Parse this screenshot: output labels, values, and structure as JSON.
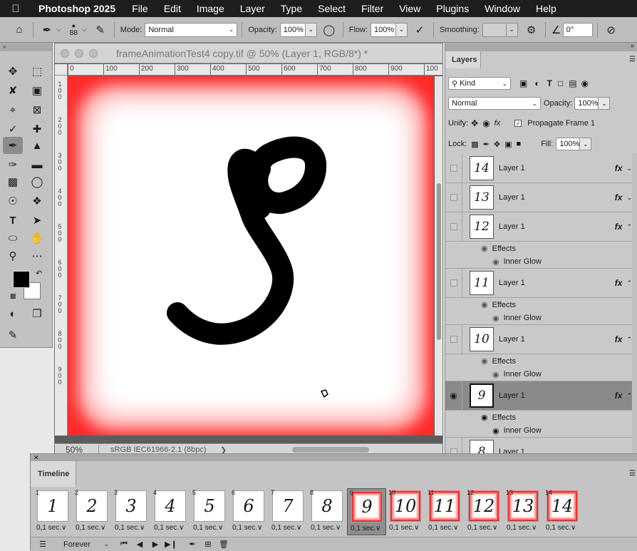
{
  "menubar": {
    "app": "Photoshop 2025",
    "items": [
      "File",
      "Edit",
      "Image",
      "Layer",
      "Type",
      "Select",
      "Filter",
      "View",
      "Plugins",
      "Window",
      "Help"
    ]
  },
  "options": {
    "brush_size": "88",
    "mode_label": "Mode:",
    "mode_value": "Normal",
    "opacity_label": "Opacity:",
    "opacity_value": "100%",
    "flow_label": "Flow:",
    "flow_value": "100%",
    "smoothing_label": "Smoothing:",
    "smoothing_value": "",
    "angle_value": "0°"
  },
  "document": {
    "title": "frameAnimationTest4 copy.tif @ 50% (Layer 1, RGB/8*) *",
    "zoom": "50%",
    "profile": "sRGB IEC61966-2.1 (8bpc)",
    "arrow": "❯",
    "ruler_h": [
      "0",
      "100",
      "200",
      "300",
      "400",
      "500",
      "600",
      "700",
      "800",
      "900",
      "100"
    ],
    "ruler_v": [
      "1 0 0",
      "2 0 0",
      "3 0 0",
      "4 0 0",
      "5 0 0",
      "6 0 0",
      "7 0 0",
      "8 0 0",
      "9 0 0"
    ]
  },
  "layers_panel": {
    "tab": "Layers",
    "filter_kind": "Kind",
    "blend_mode": "Normal",
    "opacity_label": "Opacity:",
    "opacity_value": "100%",
    "unify_label": "Unify:",
    "propagate_label": "Propagate Frame 1",
    "lock_label": "Lock:",
    "fill_label": "Fill:",
    "fill_value": "100%",
    "effects_label": "Effects",
    "inner_glow_label": "Inner Glow",
    "layers": [
      {
        "name": "Layer 1",
        "thumb": "14",
        "fx": "fx",
        "visible": false,
        "expanded": false
      },
      {
        "name": "Layer 1",
        "thumb": "13",
        "fx": "fx",
        "visible": false,
        "expanded": false
      },
      {
        "name": "Layer 1",
        "thumb": "12",
        "fx": "fx",
        "visible": false,
        "expanded": true
      },
      {
        "name": "Layer 1",
        "thumb": "11",
        "fx": "fx",
        "visible": false,
        "expanded": true
      },
      {
        "name": "Layer 1",
        "thumb": "10",
        "fx": "fx",
        "visible": false,
        "expanded": true
      },
      {
        "name": "Layer 1",
        "thumb": "9",
        "fx": "fx",
        "visible": true,
        "expanded": true,
        "selected": true
      },
      {
        "name": "Layer 1",
        "thumb": "8",
        "fx": "",
        "visible": false,
        "expanded": false
      }
    ]
  },
  "timeline": {
    "tab": "Timeline",
    "loop": "Forever",
    "frames": [
      {
        "num": "1",
        "label": "1",
        "delay": "0,1 sec.∨",
        "glow": false
      },
      {
        "num": "2",
        "label": "2",
        "delay": "0,1 sec.∨",
        "glow": false
      },
      {
        "num": "3",
        "label": "3",
        "delay": "0,1 sec.∨",
        "glow": false
      },
      {
        "num": "4",
        "label": "4",
        "delay": "0,1 sec.∨",
        "glow": false
      },
      {
        "num": "5",
        "label": "5",
        "delay": "0,1 sec.∨",
        "glow": false
      },
      {
        "num": "6",
        "label": "6",
        "delay": "0,1 sec.∨",
        "glow": false
      },
      {
        "num": "7",
        "label": "7",
        "delay": "0,1 sec.∨",
        "glow": false
      },
      {
        "num": "8",
        "label": "8",
        "delay": "0,1 sec.∨",
        "glow": false
      },
      {
        "num": "9",
        "label": "9",
        "delay": "0,1 sec.∨",
        "glow": true,
        "selected": true
      },
      {
        "num": "10",
        "label": "10",
        "delay": "0,1 sec.∨",
        "glow": true
      },
      {
        "num": "11",
        "label": "11",
        "delay": "0,1 sec.∨",
        "glow": true
      },
      {
        "num": "12",
        "label": "12",
        "delay": "0,1 sec.∨",
        "glow": true
      },
      {
        "num": "13",
        "label": "13",
        "delay": "0,1 sec.∨",
        "glow": true
      },
      {
        "num": "14",
        "label": "14",
        "delay": "0,1 sec.∨",
        "glow": true
      }
    ]
  },
  "colors": {
    "canvas_red": "#ff2a2a",
    "menubar": "#1e1e1e",
    "panel": "#c9c9c9"
  }
}
